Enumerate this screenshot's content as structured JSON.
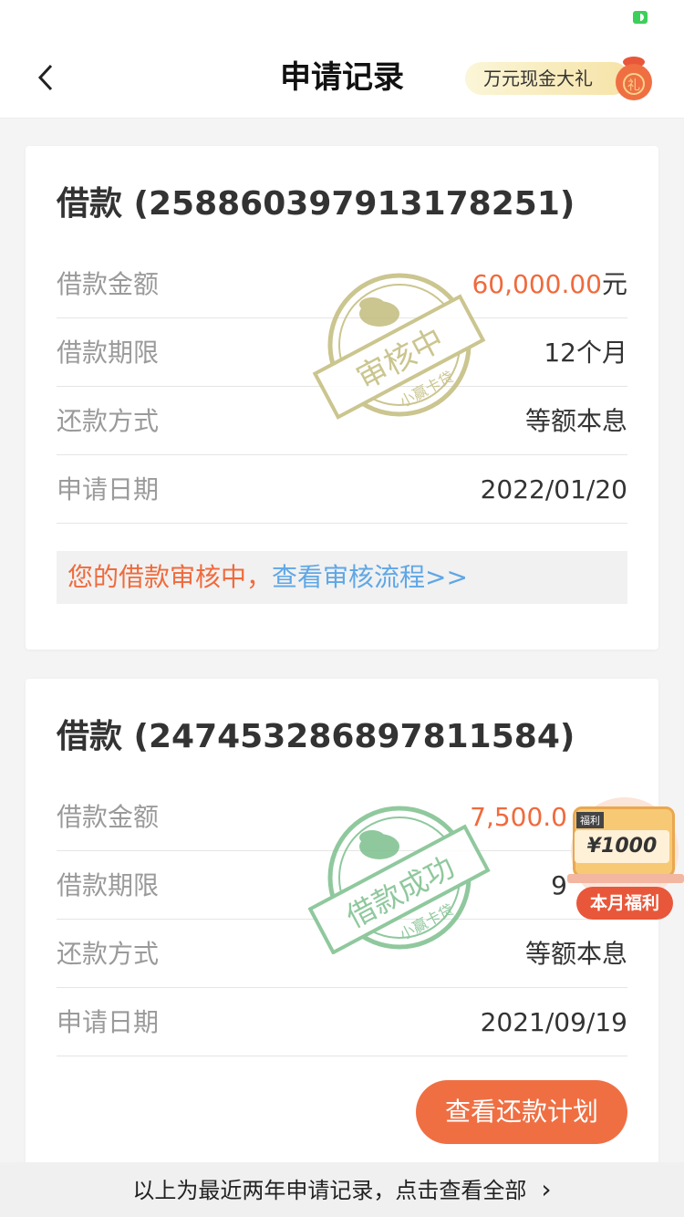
{
  "header": {
    "title": "申请记录",
    "promo_label": "万元现金大礼",
    "promo_bag_char": "礼"
  },
  "records": [
    {
      "title": "借款 (258860397913178251)",
      "rows": [
        {
          "label": "借款金额",
          "value_highlight": "60,000.00",
          "value_suffix": "元"
        },
        {
          "label": "借款期限",
          "value": "12个月"
        },
        {
          "label": "还款方式",
          "value": "等额本息"
        },
        {
          "label": "申请日期",
          "value": "2022/01/20"
        }
      ],
      "notice_status": "您的借款审核中，",
      "notice_link": "查看审核流程>>",
      "stamp": {
        "main": "审核中",
        "sub": "小赢卡贷",
        "color": "#c2bb7c"
      }
    },
    {
      "title": "借款 (247453286897811584)",
      "rows": [
        {
          "label": "借款金额",
          "value_highlight": "7,500.0"
        },
        {
          "label": "借款期限",
          "value": "9"
        },
        {
          "label": "还款方式",
          "value": "等额本息"
        },
        {
          "label": "申请日期",
          "value": "2021/09/19"
        }
      ],
      "action_label": "查看还款计划",
      "stamp": {
        "main": "借款成功",
        "sub": "小赢卡贷",
        "color": "#7cbf8c"
      }
    }
  ],
  "benefit": {
    "tag": "福利",
    "amount": "¥1000",
    "label": "本月福利"
  },
  "footer": {
    "text": "以上为最近两年申请记录，点击查看全部"
  },
  "colors": {
    "accent_orange": "#f06a3c",
    "link_blue": "#5fa7e6",
    "button_orange": "#ef6f43"
  }
}
